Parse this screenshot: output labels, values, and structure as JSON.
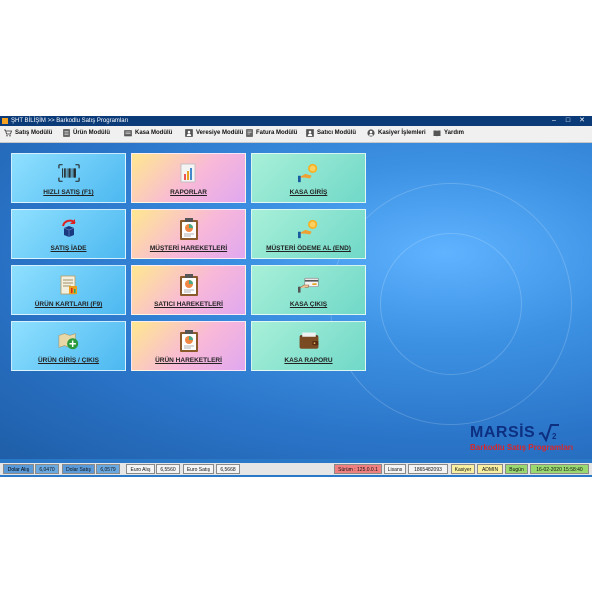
{
  "window": {
    "title": "ŞHT BİLİŞİM >> Barkodlu Satış Programları",
    "minimize": "–",
    "maximize": "□",
    "close": "✕"
  },
  "menu": [
    {
      "label": "Satış Modülü",
      "icon": "cart-icon"
    },
    {
      "label": "Ürün Modülü",
      "icon": "document-icon"
    },
    {
      "label": "Kasa Modülü",
      "icon": "cashbox-icon"
    },
    {
      "label": "Veresiye Modülü",
      "icon": "person-card-icon"
    },
    {
      "label": "Fatura Modülü",
      "icon": "invoice-icon"
    },
    {
      "label": "Satıcı Modülü",
      "icon": "seller-card-icon"
    },
    {
      "label": "Kasiyer İşlemleri",
      "icon": "user-icon"
    },
    {
      "label": "Yardım",
      "icon": "help-book-icon"
    }
  ],
  "tiles": [
    {
      "label": "HIZLI SATIŞ (F1)",
      "icon": "barcode-icon",
      "style": "blue"
    },
    {
      "label": "RAPORLAR",
      "icon": "report-chart-icon",
      "style": "pink"
    },
    {
      "label": "KASA GİRİŞ",
      "icon": "coin-hand-icon",
      "style": "green"
    },
    {
      "label": "SATIŞ İADE",
      "icon": "return-box-icon",
      "style": "blue"
    },
    {
      "label": "MÜŞTERİ HAREKETLERİ",
      "icon": "clipboard-chart-icon",
      "style": "pink"
    },
    {
      "label": "MÜŞTERİ ÖDEME AL (END)",
      "icon": "coin-hand-icon",
      "style": "green"
    },
    {
      "label": "ÜRÜN KARTLARI (F9)",
      "icon": "product-card-icon",
      "style": "blue"
    },
    {
      "label": "SATICI HAREKETLERİ",
      "icon": "clipboard-chart-icon",
      "style": "pink"
    },
    {
      "label": "KASA ÇIKIŞ",
      "icon": "card-hand-icon",
      "style": "green"
    },
    {
      "label": "ÜRÜN GİRİŞ / ÇIKIŞ",
      "icon": "map-plus-icon",
      "style": "blue"
    },
    {
      "label": "ÜRÜN HAREKETLERİ",
      "icon": "clipboard-chart-icon",
      "style": "pink"
    },
    {
      "label": "KASA RAPORU",
      "icon": "wallet-icon",
      "style": "green"
    }
  ],
  "logo": {
    "brand": "MARSİS",
    "subtitle": "Barkodlu Satış Programları"
  },
  "status": {
    "dolar_alis_label": "Dolar Alış",
    "dolar_alis_value": "6,0470",
    "dolar_satis_label": "Dolar Satış",
    "dolar_satis_value": "6,0579",
    "euro_alis_label": "Euro Alış",
    "euro_alis_value": "6,5560",
    "euro_satis_label": "Euro Satış",
    "euro_satis_value": "6,5668",
    "surum": "Sürüm : 125.0.0.1",
    "lisans_label": "Lisans",
    "lisans_value": "1865482093",
    "kasiyer_label": "Kasiyer",
    "kasiyer_value": "ADMIN",
    "bugun_label": "Bugün",
    "bugun_value": "16-02-2020 15:58:40"
  },
  "colors": {
    "accent_blue": "#2a78c8",
    "title_bar": "#0a3a78",
    "brand_navy": "#0d2f80",
    "brand_red": "#d8262a"
  }
}
